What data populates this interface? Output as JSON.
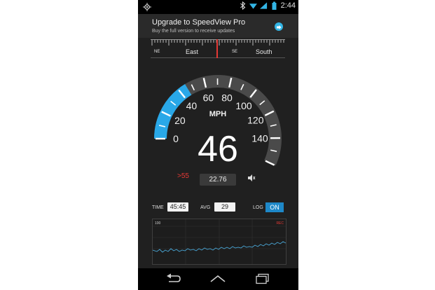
{
  "status": {
    "time": "2:44"
  },
  "banner": {
    "title": "Upgrade to SpeedView Pro",
    "subtitle": "Buy the full version to receive updates"
  },
  "compass": {
    "labels": [
      "NE",
      "East",
      "SE",
      "South"
    ]
  },
  "gauge": {
    "unit": "MPH",
    "speed": "46",
    "ticks": [
      "0",
      "20",
      "40",
      "60",
      "80",
      "100",
      "120",
      "140"
    ],
    "max_value": 160,
    "current_value": 46,
    "accent": "#29a8e8"
  },
  "limit": {
    "label": ">55"
  },
  "trip": {
    "distance": "22.76"
  },
  "stats": {
    "time_label": "TIME",
    "time_value": "45:45",
    "avg_label": "AVG",
    "avg_value": "29",
    "log_label": "LOG",
    "log_state": "ON"
  },
  "graph": {
    "top_label": "100",
    "rec_label": "REC"
  },
  "nav": {
    "buttons": [
      "back-icon",
      "home-icon",
      "recents-icon"
    ]
  }
}
